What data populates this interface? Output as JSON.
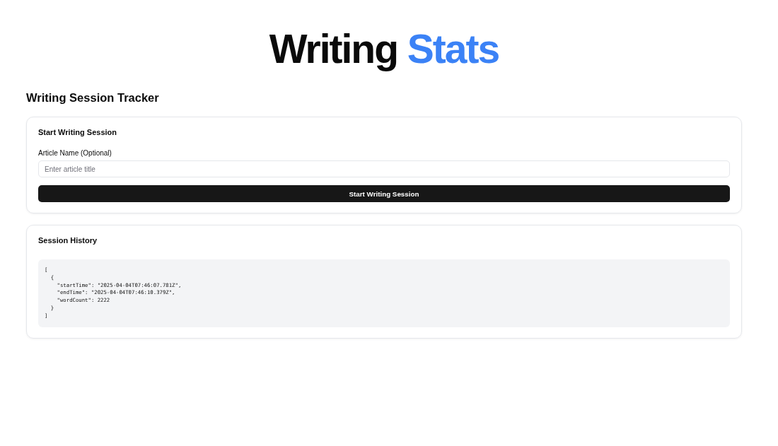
{
  "title": {
    "parts": [
      {
        "text": "Writing",
        "accent": false
      },
      {
        "text": "Stats",
        "accent": true
      }
    ]
  },
  "section_heading": "Writing Session Tracker",
  "start_card": {
    "title": "Start Writing Session",
    "field_label": "Article Name (Optional)",
    "placeholder": "Enter article title",
    "button": "Start Writing Session"
  },
  "history_card": {
    "title": "Session History",
    "code": "[\n  {\n    \"startTime\": \"2025-04-04T07:46:07.781Z\",\n    \"endTime\": \"2025-04-04T07:46:10.379Z\",\n    \"wordCount\": 2222\n  }\n]"
  }
}
